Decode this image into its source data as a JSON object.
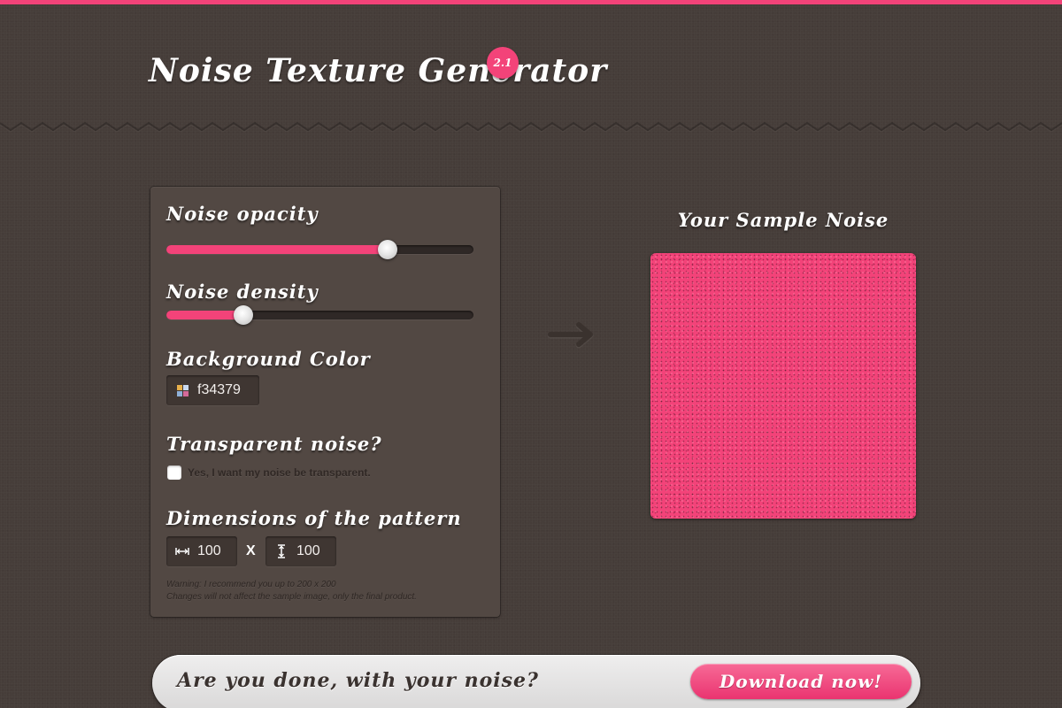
{
  "header": {
    "title": "Noise Texture Generator",
    "version": "2.1"
  },
  "panel": {
    "opacity": {
      "label": "Noise opacity",
      "value_fraction": 0.72
    },
    "density": {
      "label": "Noise density",
      "value_fraction": 0.25
    },
    "background_color": {
      "label": "Background Color",
      "value": "f34379",
      "icon": "color-palette-icon"
    },
    "transparent": {
      "label": "Transparent noise?",
      "checkbox_label": "Yes, I want my noise be transparent.",
      "checked": false
    },
    "dimensions": {
      "label": "Dimensions of the pattern",
      "width": "100",
      "height": "100",
      "separator": "X",
      "width_icon": "width-arrows-icon",
      "height_icon": "height-arrows-icon"
    },
    "warning_line1": "Warning: I recommend you up to 200 x 200",
    "warning_line2": "Changes will not affect the sample image, only the final product."
  },
  "sample": {
    "title": "Your Sample Noise",
    "color": "#f34379"
  },
  "download": {
    "question": "Are you done, with your noise?",
    "button_label": "Download now!"
  },
  "colors": {
    "accent": "#f34379",
    "background": "#463d39",
    "panel": "#524843"
  }
}
